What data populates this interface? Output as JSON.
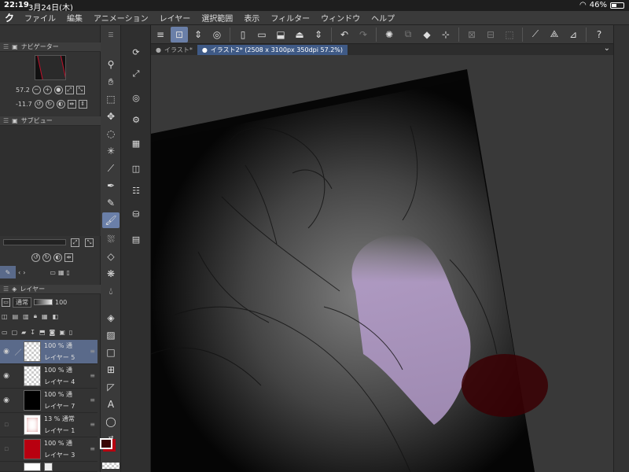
{
  "status": {
    "time": "22:19",
    "date": "3月24日(木)",
    "battery": "46%",
    "battery_level": 0.46
  },
  "menu": {
    "logo": "ク",
    "items": [
      "ファイル",
      "編集",
      "アニメーション",
      "レイヤー",
      "選択範囲",
      "表示",
      "フィルター",
      "ウィンドウ",
      "ヘルプ"
    ]
  },
  "navigator": {
    "title": "ナビゲーター",
    "zoom": "57.2",
    "rotation": "-11.7"
  },
  "subview": {
    "title": "サブビュー"
  },
  "layers_panel": {
    "title": "レイヤー",
    "blend_mode": "通常",
    "opacity": "100"
  },
  "layers": [
    {
      "opacity": "100 %",
      "mode": "通",
      "name": "レイヤー 5",
      "selected": true,
      "thumb": "checker"
    },
    {
      "opacity": "100 %",
      "mode": "通",
      "name": "レイヤー 4",
      "selected": false,
      "thumb": "checker"
    },
    {
      "opacity": "100 %",
      "mode": "通",
      "name": "レイヤー 7",
      "selected": false,
      "thumb": "black"
    },
    {
      "opacity": "13 %",
      "mode": "通常",
      "name": "レイヤー 1",
      "selected": false,
      "thumb": "sketch"
    },
    {
      "opacity": "100 %",
      "mode": "通",
      "name": "レイヤー 3",
      "selected": false,
      "thumb": "red"
    }
  ],
  "tabs": [
    {
      "label": "イラスト*",
      "active": false
    },
    {
      "label": "イラスト2* (2508 x 3100px 350dpi 57.2%)",
      "active": true
    }
  ],
  "colors": {
    "main": "#3a0505",
    "sub": "#b80010",
    "accent": "#6a7fa8"
  }
}
